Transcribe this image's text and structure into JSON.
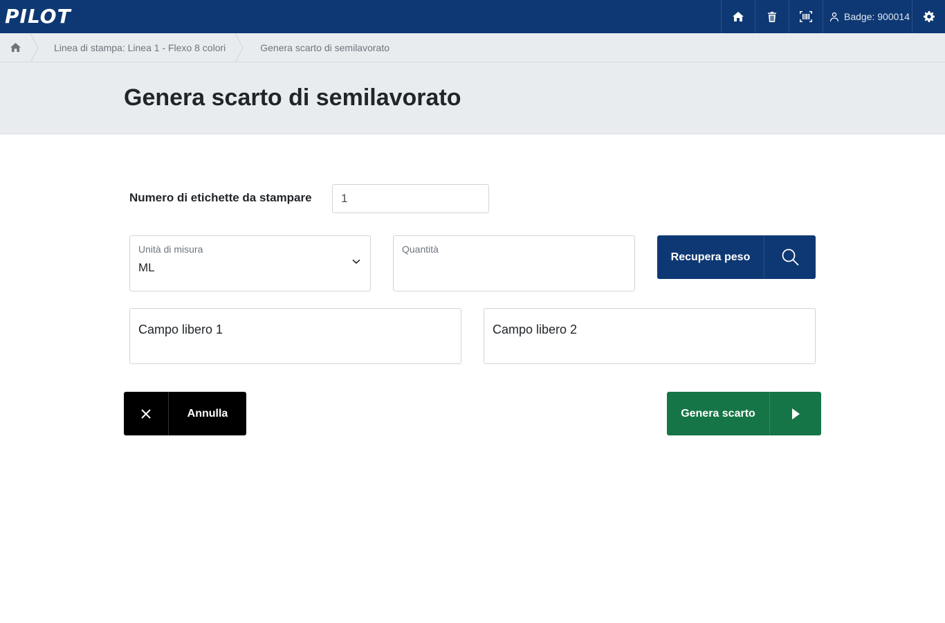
{
  "app": {
    "logo_text": "PILOT"
  },
  "topbar": {
    "home_icon": "home-icon",
    "trash_icon": "trash-icon",
    "barcode_icon": "barcode-icon",
    "badge_label": "Badge: 900014",
    "settings_icon": "gear-icon"
  },
  "breadcrumb": {
    "items": [
      {
        "label": "Linea di stampa: Linea 1 - Flexo 8 colori"
      },
      {
        "label": "Genera scarto di semilavorato"
      }
    ]
  },
  "page": {
    "title": "Genera scarto di semilavorato"
  },
  "form": {
    "etichette_label": "Numero di etichette da stampare",
    "etichette_value": "1",
    "unita_label": "Unità di misura",
    "unita_value": "ML",
    "quantita_label": "Quantità",
    "quantita_value": "",
    "recupera_label": "Recupera peso",
    "campo1_placeholder": "Campo libero 1",
    "campo2_placeholder": "Campo libero 2",
    "annulla_label": "Annulla",
    "genera_label": "Genera scarto"
  },
  "colors": {
    "primary": "#0e3873",
    "success": "#157547",
    "dark": "#000000"
  }
}
